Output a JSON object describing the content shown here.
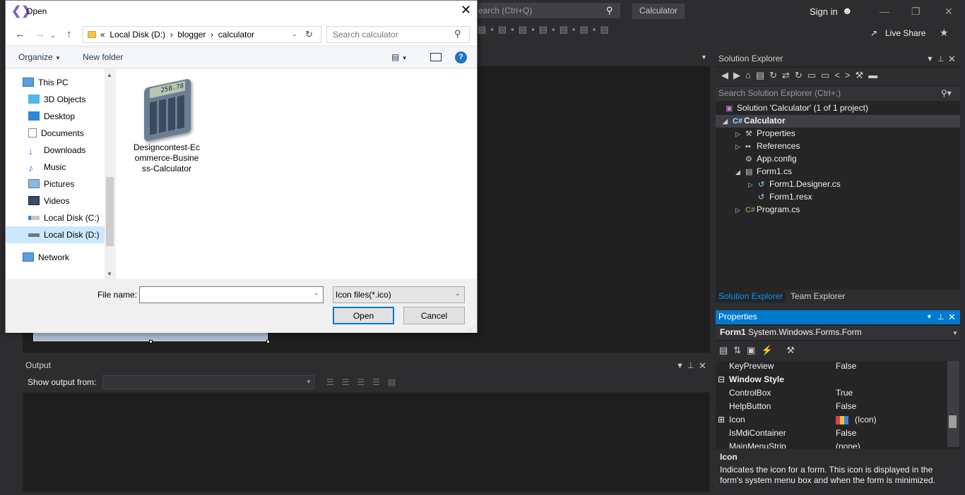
{
  "vs": {
    "search_placeholder": "Search (Ctrl+Q)",
    "app_title": "Calculator",
    "sign_in": "Sign in",
    "live_share": "Live Share"
  },
  "output": {
    "title": "Output",
    "show_output_from": "Show output from:"
  },
  "solution_explorer": {
    "title": "Solution Explorer",
    "search_placeholder": "Search Solution Explorer (Ctrl+;)",
    "tree": [
      {
        "label": "Solution 'Calculator' (1 of 1 project)"
      },
      {
        "label": "Calculator"
      },
      {
        "label": "Properties"
      },
      {
        "label": "References"
      },
      {
        "label": "App.config"
      },
      {
        "label": "Form1.cs"
      },
      {
        "label": "Form1.Designer.cs"
      },
      {
        "label": "Form1.resx"
      },
      {
        "label": "Program.cs"
      }
    ],
    "tabs": [
      "Solution Explorer",
      "Team Explorer"
    ]
  },
  "properties": {
    "title": "Properties",
    "object_name": "Form1",
    "object_type": "System.Windows.Forms.Form",
    "rows": [
      {
        "name": "KeyPreview",
        "value": "False"
      },
      {
        "name": "Window Style",
        "value": ""
      },
      {
        "name": "ControlBox",
        "value": "True"
      },
      {
        "name": "HelpButton",
        "value": "False"
      },
      {
        "name": "Icon",
        "value": "(Icon)"
      },
      {
        "name": "IsMdiContainer",
        "value": "False"
      },
      {
        "name": "MainMenuStrip",
        "value": "(none)"
      }
    ],
    "desc_title": "Icon",
    "desc_text": "Indicates the icon for a form. This icon is displayed in the form's system menu box and when the form is minimized."
  },
  "dialog": {
    "title": "Open",
    "breadcrumb": {
      "overflow": "«",
      "items": [
        "Local Disk (D:)",
        "blogger",
        "calculator"
      ]
    },
    "search_placeholder": "Search calculator",
    "organize": "Organize",
    "new_folder": "New folder",
    "nav_items": [
      {
        "label": "This PC",
        "icon": "computer-icon"
      },
      {
        "label": "3D Objects",
        "icon": "cube-icon"
      },
      {
        "label": "Desktop",
        "icon": "desktop-icon"
      },
      {
        "label": "Documents",
        "icon": "document-icon"
      },
      {
        "label": "Downloads",
        "icon": "download-icon"
      },
      {
        "label": "Music",
        "icon": "music-icon"
      },
      {
        "label": "Pictures",
        "icon": "pictures-icon"
      },
      {
        "label": "Videos",
        "icon": "video-icon"
      },
      {
        "label": "Local Disk (C:)",
        "icon": "drive-icon"
      },
      {
        "label": "Local Disk (D:)",
        "icon": "drive-icon"
      },
      {
        "label": "Network",
        "icon": "network-icon"
      }
    ],
    "file": {
      "name_line1": "Designcontest-Ec",
      "name_line2": "ommerce-Busine",
      "name_line3": "ss-Calculator",
      "display": "258.78"
    },
    "file_name_label": "File name:",
    "file_name_value": "",
    "filter": "Icon files(*.ico)",
    "open": "Open",
    "cancel": "Cancel"
  }
}
